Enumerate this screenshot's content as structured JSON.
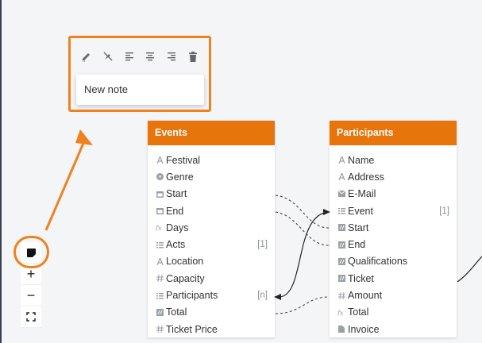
{
  "note": {
    "text": "New note",
    "toolbar": [
      "edit-icon",
      "color-off-icon",
      "align-left-icon",
      "align-center-icon",
      "align-right-icon",
      "trash-icon"
    ]
  },
  "zoom_controls": [
    "sticky-note-icon",
    "zoom-in-icon",
    "zoom-out-icon",
    "fit-screen-icon"
  ],
  "zoom_labels": {
    "in": "+",
    "out": "−"
  },
  "tables": {
    "events": {
      "title": "Events",
      "rows": [
        {
          "icon": "text",
          "label": "Festival",
          "card": ""
        },
        {
          "icon": "select",
          "label": "Genre",
          "card": ""
        },
        {
          "icon": "date",
          "label": "Start",
          "card": ""
        },
        {
          "icon": "date",
          "label": "End",
          "card": ""
        },
        {
          "icon": "formula",
          "label": "Days",
          "card": ""
        },
        {
          "icon": "link",
          "label": "Acts",
          "card": "[1]"
        },
        {
          "icon": "text",
          "label": "Location",
          "card": ""
        },
        {
          "icon": "number",
          "label": "Capacity",
          "card": ""
        },
        {
          "icon": "link",
          "label": "Participants",
          "card": "[n]"
        },
        {
          "icon": "lookup",
          "label": "Total",
          "card": ""
        },
        {
          "icon": "number",
          "label": "Ticket Price",
          "card": ""
        }
      ]
    },
    "participants": {
      "title": "Participants",
      "rows": [
        {
          "icon": "text",
          "label": "Name",
          "card": ""
        },
        {
          "icon": "text",
          "label": "Address",
          "card": ""
        },
        {
          "icon": "email",
          "label": "E-Mail",
          "card": ""
        },
        {
          "icon": "link",
          "label": "Event",
          "card": "[1]"
        },
        {
          "icon": "lookup",
          "label": "Start",
          "card": ""
        },
        {
          "icon": "lookup",
          "label": "End",
          "card": ""
        },
        {
          "icon": "lookup",
          "label": "Qualifications",
          "card": ""
        },
        {
          "icon": "lookup",
          "label": "Ticket",
          "card": ""
        },
        {
          "icon": "number",
          "label": "Amount",
          "card": ""
        },
        {
          "icon": "formula",
          "label": "Total",
          "card": ""
        },
        {
          "icon": "file",
          "label": "Invoice",
          "card": ""
        }
      ]
    }
  },
  "colors": {
    "accent": "#f0811f",
    "header": "#e8740c"
  }
}
